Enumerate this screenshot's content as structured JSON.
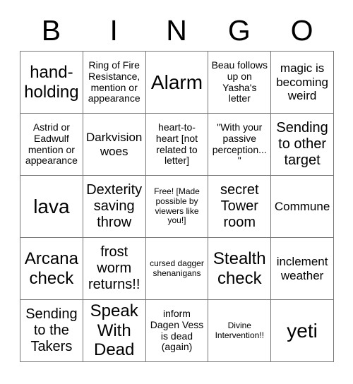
{
  "card": {
    "header_letters": [
      "B",
      "I",
      "N",
      "G",
      "O"
    ],
    "colors": {
      "background": "#ffffff",
      "text": "#000000",
      "grid_line": "#777777"
    },
    "rows": [
      [
        {
          "text": "hand-holding",
          "size": "xl"
        },
        {
          "text": "Ring of Fire Resistance, mention or appearance",
          "size": "sm"
        },
        {
          "text": "Alarm",
          "size": "xxl"
        },
        {
          "text": "Beau follows up on Yasha's letter",
          "size": "sm"
        },
        {
          "text": "magic is becoming weird",
          "size": "md"
        }
      ],
      [
        {
          "text": "Astrid or Eadwulf mention or appearance",
          "size": "sm"
        },
        {
          "text": "Darkvision woes",
          "size": "md"
        },
        {
          "text": "heart-to-heart [not related to letter]",
          "size": "sm"
        },
        {
          "text": "\"With your passive perception...\"",
          "size": "sm"
        },
        {
          "text": "Sending to other target",
          "size": "lg"
        }
      ],
      [
        {
          "text": "lava",
          "size": "xxl"
        },
        {
          "text": "Dexterity saving throw",
          "size": "lg"
        },
        {
          "text": "Free! [Made possible by viewers like you!]",
          "size": "xs"
        },
        {
          "text": "secret Tower room",
          "size": "lg"
        },
        {
          "text": "Commune",
          "size": "md"
        }
      ],
      [
        {
          "text": "Arcana check",
          "size": "xl"
        },
        {
          "text": "frost worm returns!!",
          "size": "lg"
        },
        {
          "text": "cursed dagger shenanigans",
          "size": "xs"
        },
        {
          "text": "Stealth check",
          "size": "xl"
        },
        {
          "text": "inclement weather",
          "size": "md"
        }
      ],
      [
        {
          "text": "Sending to the Takers",
          "size": "lg"
        },
        {
          "text": "Speak With Dead",
          "size": "xl"
        },
        {
          "text": "inform Dagen Vess is dead (again)",
          "size": "sm"
        },
        {
          "text": "Divine Intervention!!",
          "size": "xs"
        },
        {
          "text": "yeti",
          "size": "xxl"
        }
      ]
    ]
  }
}
